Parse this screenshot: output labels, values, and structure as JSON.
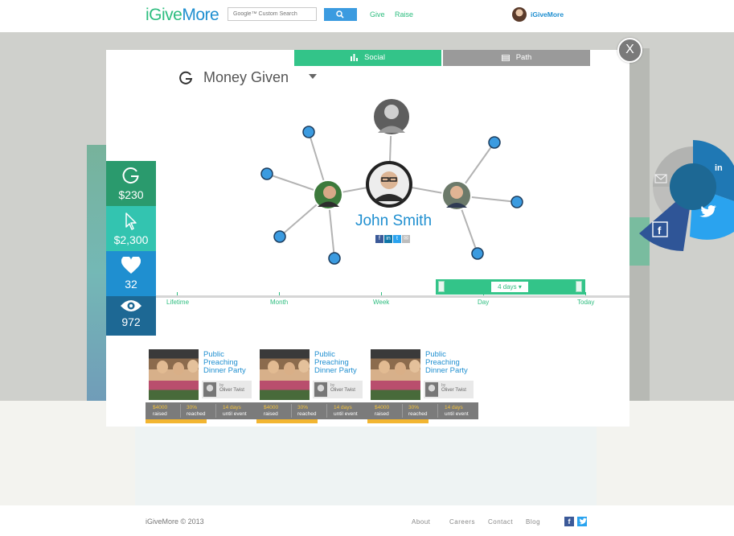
{
  "header": {
    "logo_give": "iGive",
    "logo_more": "More",
    "search_placeholder": "Google™ Custom Search",
    "nav": [
      "Give",
      "Raise"
    ],
    "user_name": "iGiveMore"
  },
  "modal": {
    "tabs": [
      {
        "label": "Social",
        "active": true
      },
      {
        "label": "Path",
        "active": false
      }
    ],
    "metric_label": "Money Given",
    "close_label": "X",
    "center_person": "John Smith"
  },
  "stats": {
    "given": "$230",
    "clicks": "$2,300",
    "likes": "32",
    "views": "972"
  },
  "timeline": {
    "labels": [
      "Lifetime",
      "Month",
      "Week",
      "Day",
      "Today"
    ],
    "range_label": "4 days"
  },
  "cards": [
    {
      "title": "Public Preaching Dinner Party",
      "by": "by",
      "author": "Oliver Twist",
      "raised_value": "$4000",
      "raised_label": "raised",
      "reached_value": "30%",
      "reached_label": "reached",
      "days_value": "14 days",
      "days_label": "until event",
      "progress": 0.55
    },
    {
      "title": "Public Preaching Dinner Party",
      "by": "by",
      "author": "Oliver Twist",
      "raised_value": "$4000",
      "raised_label": "raised",
      "reached_value": "30%",
      "reached_label": "reached",
      "days_value": "14 days",
      "days_label": "until event",
      "progress": 0.55
    },
    {
      "title": "Public Preaching Dinner Party",
      "by": "by",
      "author": "Oliver Twist",
      "raised_value": "$4000",
      "raised_label": "raised",
      "reached_value": "30%",
      "reached_label": "reached",
      "days_value": "14 days",
      "days_label": "until event",
      "progress": 0.55
    }
  ],
  "social_wheel": {
    "linkedin": "in",
    "facebook": "f"
  },
  "footer": {
    "copyright": "iGiveMore © 2013",
    "links": [
      "About",
      "Careers",
      "Contact",
      "Blog"
    ],
    "facebook": "f"
  },
  "colors": {
    "green": "#33c489",
    "blue": "#1f8fd0",
    "gray_tab": "#9a9a9a",
    "progress": "#f2b531"
  }
}
